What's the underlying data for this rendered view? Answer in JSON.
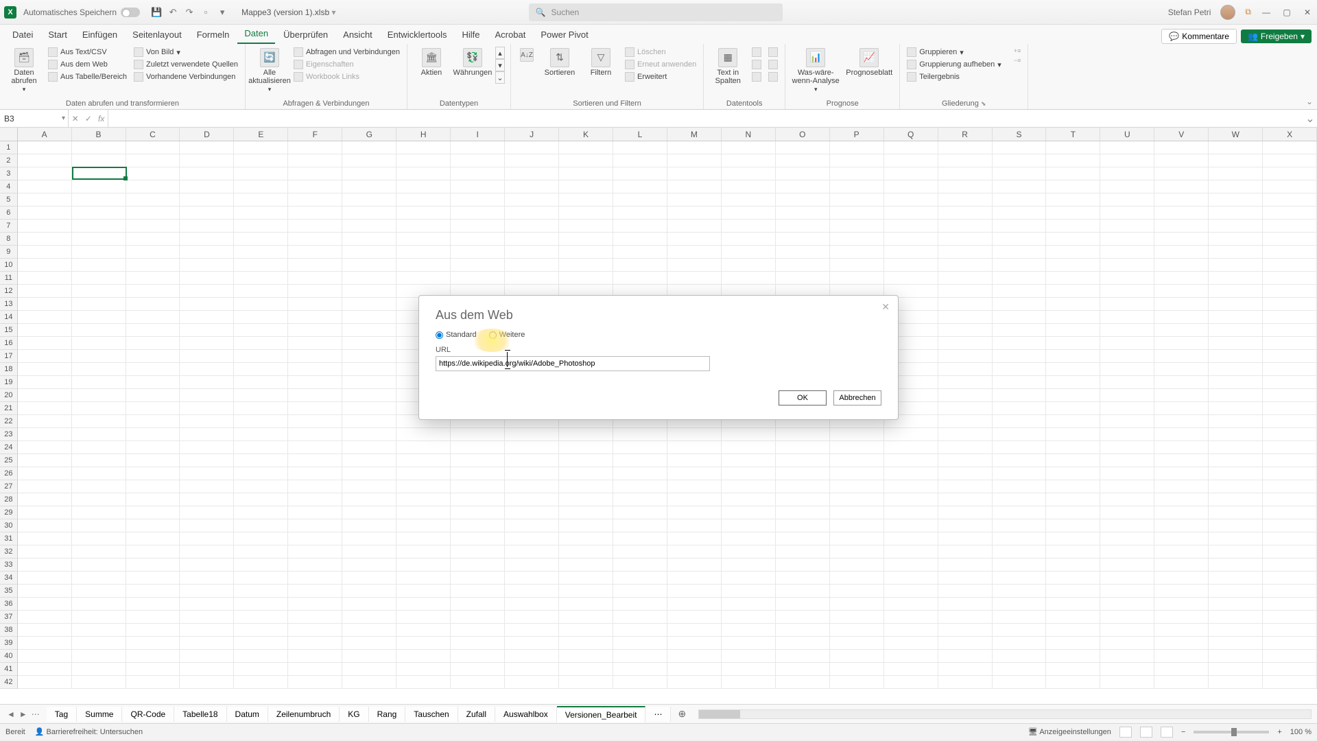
{
  "titlebar": {
    "autosave_label": "Automatisches Speichern",
    "filename": "Mappe3 (version 1).xlsb",
    "search_placeholder": "Suchen",
    "username": "Stefan Petri"
  },
  "tabs": {
    "items": [
      "Datei",
      "Start",
      "Einfügen",
      "Seitenlayout",
      "Formeln",
      "Daten",
      "Überprüfen",
      "Ansicht",
      "Entwicklertools",
      "Hilfe",
      "Acrobat",
      "Power Pivot"
    ],
    "active_index": 5,
    "comments": "Kommentare",
    "share": "Freigeben"
  },
  "ribbon": {
    "g1": {
      "btn": "Daten abrufen",
      "r1": "Aus Text/CSV",
      "r2": "Aus dem Web",
      "r3": "Aus Tabelle/Bereich",
      "r4": "Von Bild",
      "r5": "Zuletzt verwendete Quellen",
      "r6": "Vorhandene Verbindungen",
      "label": "Daten abrufen und transformieren"
    },
    "g2": {
      "btn": "Alle aktualisieren",
      "r1": "Abfragen und Verbindungen",
      "r2": "Eigenschaften",
      "r3": "Workbook Links",
      "label": "Abfragen & Verbindungen"
    },
    "g3": {
      "b1": "Aktien",
      "b2": "Währungen",
      "label": "Datentypen"
    },
    "g4": {
      "b1": "Sortieren",
      "b2": "Filtern",
      "r1": "Löschen",
      "r2": "Erneut anwenden",
      "r3": "Erweitert",
      "label": "Sortieren und Filtern"
    },
    "g5": {
      "b1": "Text in Spalten",
      "label": "Datentools"
    },
    "g6": {
      "b1": "Was-wäre-wenn-Analyse",
      "b2": "Prognoseblatt",
      "label": "Prognose"
    },
    "g7": {
      "r1": "Gruppieren",
      "r2": "Gruppierung aufheben",
      "r3": "Teilergebnis",
      "label": "Gliederung"
    }
  },
  "namebox": {
    "ref": "B3"
  },
  "columns": [
    "A",
    "B",
    "C",
    "D",
    "E",
    "F",
    "G",
    "H",
    "I",
    "J",
    "K",
    "L",
    "M",
    "N",
    "O",
    "P",
    "Q",
    "R",
    "S",
    "T",
    "U",
    "V",
    "W",
    "X"
  ],
  "rows_count": 42,
  "selected_cell": {
    "col_index": 1,
    "row_index": 2
  },
  "sheets": {
    "items": [
      "Tag",
      "Summe",
      "QR-Code",
      "Tabelle18",
      "Datum",
      "Zeilenumbruch",
      "KG",
      "Rang",
      "Tauschen",
      "Zufall",
      "Auswahlbox",
      "Versionen_Bearbeit"
    ],
    "active_index": 11
  },
  "statusbar": {
    "ready": "Bereit",
    "accessibility": "Barrierefreiheit: Untersuchen",
    "display": "Anzeigeeinstellungen",
    "zoom": "100 %"
  },
  "dialog": {
    "title": "Aus dem Web",
    "radio_standard": "Standard",
    "radio_more": "Weitere",
    "url_label": "URL",
    "url_value": "https://de.wikipedia.org/wiki/Adobe_Photoshop",
    "ok": "OK",
    "cancel": "Abbrechen"
  }
}
